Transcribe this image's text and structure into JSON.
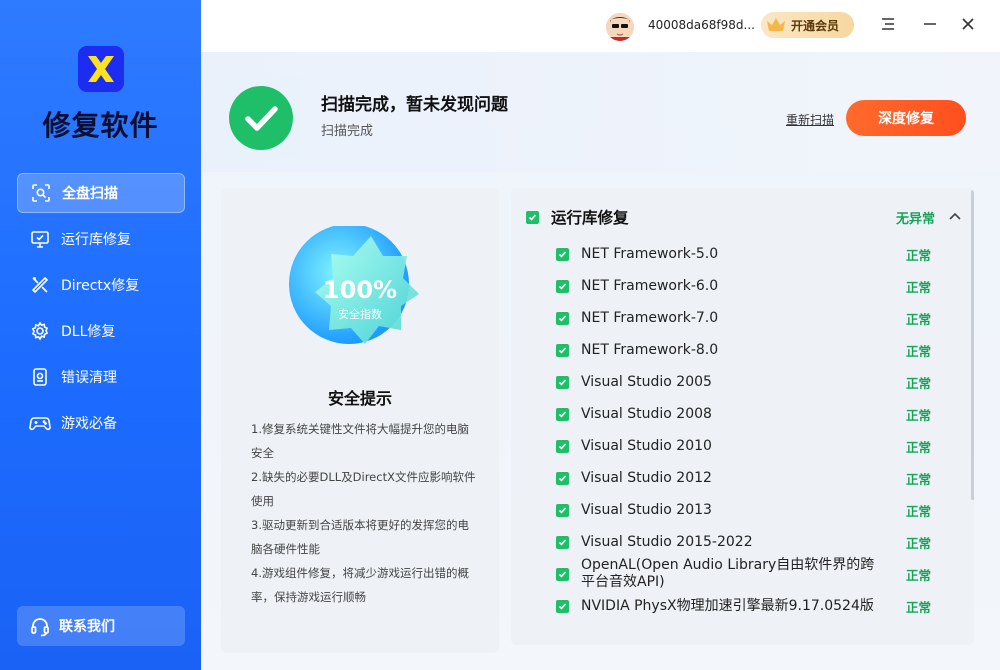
{
  "sidebar": {
    "app_name": "修复软件",
    "items": [
      {
        "label": "全盘扫描",
        "icon": "scan-icon",
        "active": true
      },
      {
        "label": "运行库修复",
        "icon": "monitor-icon",
        "active": false
      },
      {
        "label": "Directx修复",
        "icon": "tools-icon",
        "active": false
      },
      {
        "label": "DLL修复",
        "icon": "gear-icon",
        "active": false
      },
      {
        "label": "错误清理",
        "icon": "clean-icon",
        "active": false
      },
      {
        "label": "游戏必备",
        "icon": "gamepad-icon",
        "active": false
      }
    ],
    "contact_label": "联系我们"
  },
  "topbar": {
    "username": "40008da68f98d...",
    "vip_label": "开通会员"
  },
  "hero": {
    "title": "扫描完成，暂未发现问题",
    "subtitle": "扫描完成",
    "rescan_label": "重新扫描",
    "deep_repair_label": "深度修复"
  },
  "safety": {
    "score": "100%",
    "score_label": "安全指数",
    "title": "安全提示",
    "tips": [
      "1.修复系统关键性文件将大幅提升您的电脑安全",
      "2.缺失的必要DLL及DirectX文件应影响软件使用",
      "3.驱动更新到合适版本将更好的发挥您的电脑各硬件性能",
      "4.游戏组件修复，将减少游戏运行出错的概率，保持游戏运行顺畅"
    ]
  },
  "runtime": {
    "title": "运行库修复",
    "status": "无异常",
    "items": [
      {
        "name": "NET Framework-5.0",
        "status": "正常"
      },
      {
        "name": "NET Framework-6.0",
        "status": "正常"
      },
      {
        "name": "NET Framework-7.0",
        "status": "正常"
      },
      {
        "name": "NET Framework-8.0",
        "status": "正常"
      },
      {
        "name": "Visual Studio 2005",
        "status": "正常"
      },
      {
        "name": "Visual Studio 2008",
        "status": "正常"
      },
      {
        "name": "Visual Studio 2010",
        "status": "正常"
      },
      {
        "name": "Visual Studio 2012",
        "status": "正常"
      },
      {
        "name": "Visual Studio 2013",
        "status": "正常"
      },
      {
        "name": "Visual Studio 2015-2022",
        "status": "正常"
      },
      {
        "name": "OpenAL(Open Audio Library自由软件界的跨平台音效API)",
        "status": "正常"
      },
      {
        "name": "NVIDIA PhysX物理加速引擎最新9.17.0524版",
        "status": "正常"
      }
    ]
  },
  "colors": {
    "sidebar_blue": "#1d6cff",
    "success_green": "#1fbf6a",
    "accent_orange": "#ff5a24"
  }
}
